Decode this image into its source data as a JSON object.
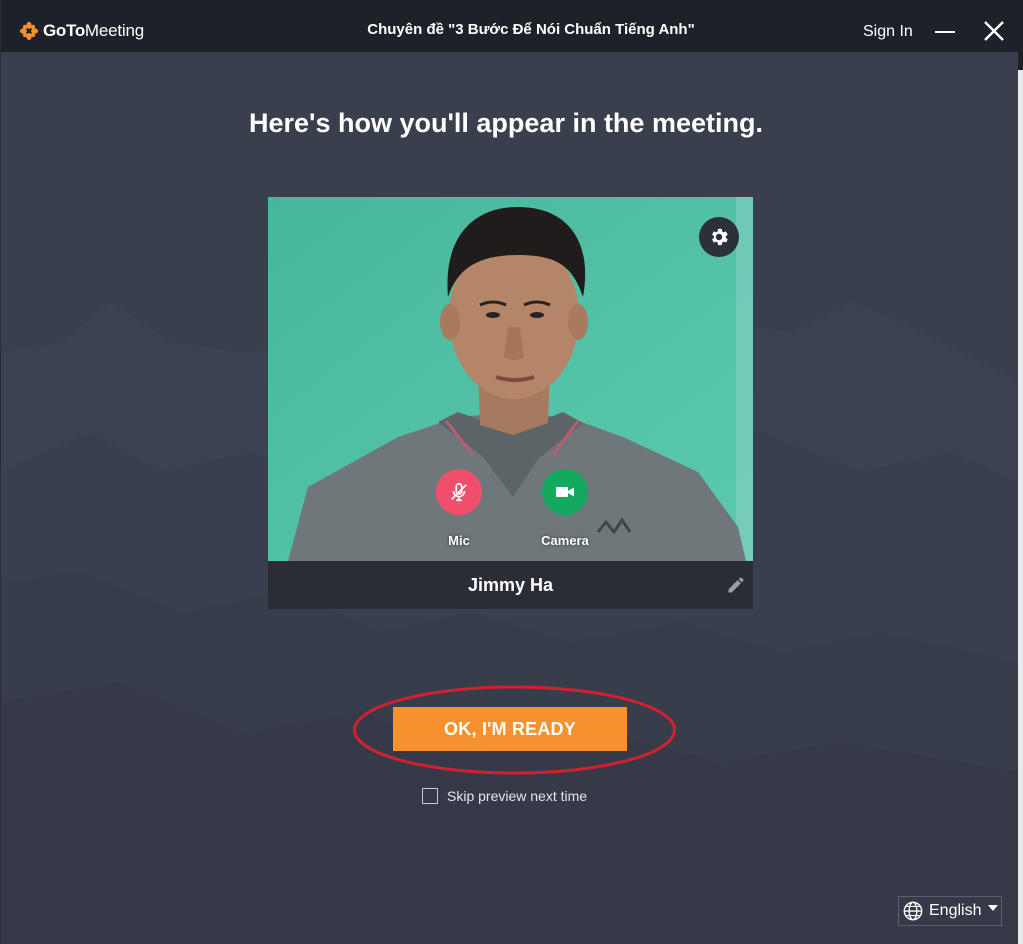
{
  "titlebar": {
    "logo_goto": "GoTo",
    "logo_meeting": "Meeting",
    "title": "Chuyên đề \"3 Bước Để Nói Chuẩn Tiếng Anh\"",
    "sign_in": "Sign In"
  },
  "main": {
    "heading": "Here's how you'll appear in the meeting.",
    "mic_label": "Mic",
    "camera_label": "Camera",
    "participant_name": "Jimmy Ha",
    "ready_button": "OK, I'M READY",
    "skip_preview_label": "Skip preview next time",
    "skip_preview_checked": false
  },
  "footer": {
    "language": "English"
  },
  "colors": {
    "accent_orange": "#f5922d",
    "mic_muted_red": "#ef4f6a",
    "camera_green": "#13a95f",
    "background": "#3a3f4e",
    "titlebar": "#1f2128",
    "highlight_ellipse": "#d3202f"
  },
  "icons": {
    "logo": "gotomeeting-flower-icon",
    "settings": "gear-icon",
    "mic": "mic-off-icon",
    "camera": "video-camera-icon",
    "edit": "pencil-icon",
    "language": "globe-icon"
  }
}
